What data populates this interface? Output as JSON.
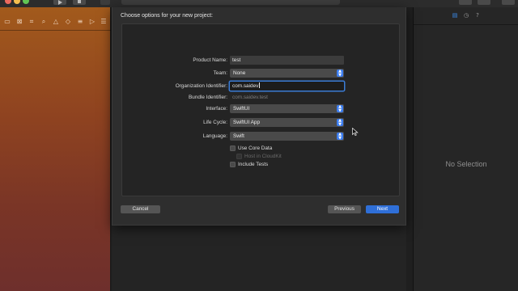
{
  "window": {
    "accent_color": "#2f6fd8",
    "traffic_lights": [
      "close",
      "minimize",
      "zoom"
    ],
    "toolbar_icons": [
      "run-icon",
      "stop-icon"
    ]
  },
  "navigator": {
    "tab_icons": [
      "folder-icon",
      "source-control-icon",
      "symbol-icon",
      "find-icon",
      "issue-icon",
      "test-icon",
      "debug-icon",
      "breakpoint-icon",
      "report-icon"
    ],
    "tab_glyphs": [
      "▭",
      "⊠",
      "⌗",
      "⌕",
      "△",
      "◇",
      "≡",
      "▷",
      "☰"
    ]
  },
  "inspector": {
    "tab_icons": [
      "file-inspector-icon",
      "history-icon",
      "help-icon"
    ],
    "tab_glyphs": [
      "▤",
      "◷",
      "?"
    ],
    "empty_label": "No Selection"
  },
  "sheet": {
    "title": "Choose options for your new project:",
    "fields": {
      "product_name": {
        "label": "Product Name:",
        "value": "test"
      },
      "team": {
        "label": "Team:",
        "value": "None"
      },
      "organization_identifier": {
        "label": "Organization Identifier:",
        "value": "com.saidev"
      },
      "bundle_identifier": {
        "label": "Bundle Identifier:",
        "value": "com.saidev.test"
      },
      "interface": {
        "label": "Interface:",
        "value": "SwiftUI"
      },
      "life_cycle": {
        "label": "Life Cycle:",
        "value": "SwiftUI App"
      },
      "language": {
        "label": "Language:",
        "value": "Swift"
      }
    },
    "checkboxes": {
      "use_core_data": {
        "label": "Use Core Data",
        "checked": false,
        "enabled": true
      },
      "host_in_cloudkit": {
        "label": "Host in CloudKit",
        "checked": false,
        "enabled": false
      },
      "include_tests": {
        "label": "Include Tests",
        "checked": false,
        "enabled": true
      }
    },
    "buttons": {
      "cancel": "Cancel",
      "previous": "Previous",
      "next": "Next"
    }
  }
}
